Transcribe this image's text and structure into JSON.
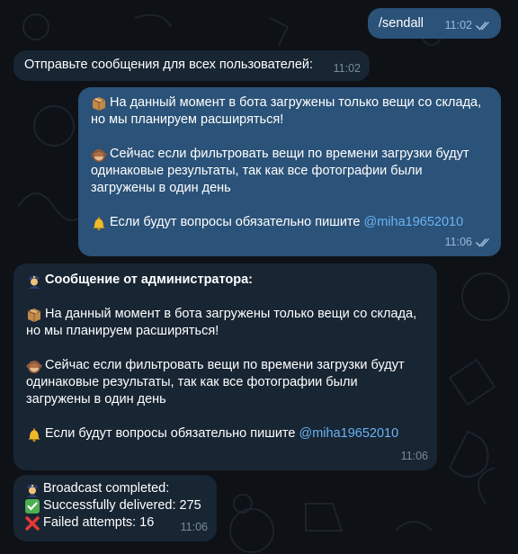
{
  "chat": {
    "messages": [
      {
        "id": "m1",
        "direction": "out",
        "text": "/sendall",
        "time": "11:02",
        "read": true
      },
      {
        "id": "m2",
        "direction": "in",
        "text": "Отправьте сообщения для всех пользователей:",
        "time": "11:02"
      },
      {
        "id": "m3",
        "direction": "out",
        "time": "11:06",
        "read": true,
        "p1": {
          "l1": "На данный момент в бота загружены только вещи со склада,",
          "l2": "но мы планируем расширяться!"
        },
        "p2": {
          "l1": "Сейчас если фильтровать вещи по времени загрузки будут",
          "l2": "одинаковые результаты, так как все фотографии были",
          "l3": "загружены в один день"
        },
        "p3": {
          "text": "Если будут вопросы обязательно пишите ",
          "mention": "@miha19652010"
        }
      },
      {
        "id": "m4",
        "direction": "in",
        "time": "11:06",
        "header": "Сообщение от администратора:",
        "p1": {
          "l1": "На данный момент в бота загружены только вещи со склада,",
          "l2": "но мы планируем расширяться!"
        },
        "p2": {
          "l1": "Сейчас если фильтровать вещи по времени загрузки будут",
          "l2": "одинаковые результаты, так как все фотографии были",
          "l3": "загружены в один день"
        },
        "p3": {
          "text": "Если будут вопросы обязательно пишите ",
          "mention": "@miha19652010"
        }
      },
      {
        "id": "m5",
        "direction": "in",
        "time": "11:06",
        "l1": "Broadcast completed:",
        "l2": "Successfully delivered: 275",
        "l3": "Failed attempts: 16"
      }
    ]
  },
  "icons": {
    "box": "package-emoji",
    "monkey": "see-no-evil-monkey-emoji",
    "bell": "bell-emoji",
    "police": "police-officer-emoji",
    "check": "check-mark-button-emoji",
    "cross": "cross-mark-emoji",
    "read": "double-check-read-icon"
  },
  "colors": {
    "background": "#0e1116",
    "outgoing_bubble": "#2b5278",
    "incoming_bubble": "#182533",
    "link": "#6ab3f3"
  }
}
